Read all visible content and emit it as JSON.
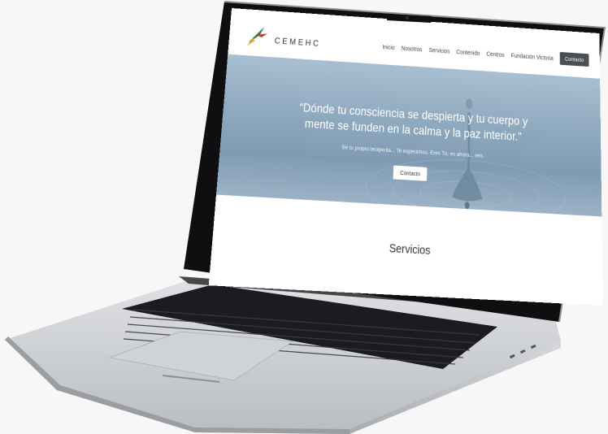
{
  "site": {
    "brand": "CEMEHC",
    "nav": [
      "Inicio",
      "Nosotros",
      "Servicios",
      "Contenido",
      "Centros",
      "Fundación Victoria"
    ],
    "nav_cta": "Contacto",
    "hero": {
      "quote": "“Dónde tu consciencia se despierta y tu cuerpo y mente se funden en la calma y la paz interior.”",
      "subtitle": "Sé tu propio terapeuta... Te esperamos. Eres Tú, es ahora... ven.",
      "button": "Contacto"
    },
    "section_title": "Servicios"
  },
  "colors": {
    "hero_blue": "#8fa9bf",
    "dark_button": "#4a4f55",
    "laptop_silver": "#c9ccd1",
    "bezel": "#111111"
  }
}
